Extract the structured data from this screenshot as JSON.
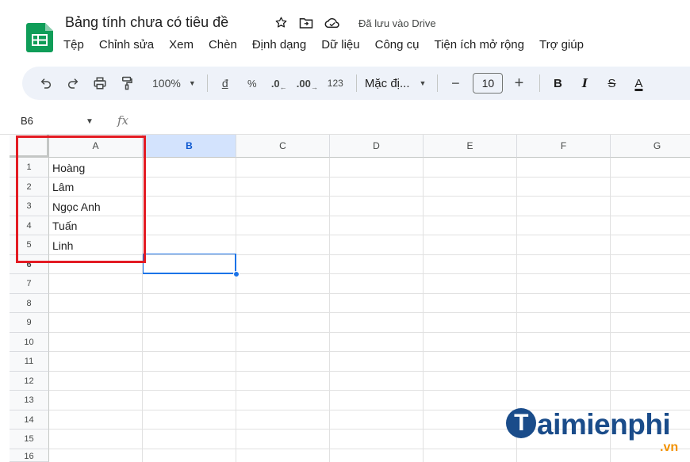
{
  "doc": {
    "title": "Bảng tính chưa có tiêu đề",
    "saved_status": "Đã lưu vào Drive"
  },
  "menu": [
    "Tệp",
    "Chỉnh sửa",
    "Xem",
    "Chèn",
    "Định dạng",
    "Dữ liệu",
    "Công cụ",
    "Tiện ích mở rộng",
    "Trợ giúp"
  ],
  "toolbar": {
    "zoom": "100%",
    "currency": "đ",
    "percent": "%",
    "dec_decrease": ".0",
    "dec_increase": ".00",
    "number_format": "123",
    "font_name": "Mặc đị...",
    "font_size": "10",
    "minus": "−",
    "plus": "+",
    "bold": "B",
    "italic": "I",
    "strike": "S",
    "text_color": "A"
  },
  "name_box": "B6",
  "formula_icon": "fx",
  "columns": [
    "A",
    "B",
    "C",
    "D",
    "E",
    "F",
    "G"
  ],
  "selected_column": "B",
  "rows": [
    "1",
    "2",
    "3",
    "4",
    "5",
    "6",
    "7",
    "8",
    "9",
    "10",
    "11",
    "12",
    "13",
    "14",
    "15",
    "16"
  ],
  "column_a": [
    "Hoàng",
    "Lâm",
    "Ngọc Anh",
    "Tuấn",
    "Linh"
  ],
  "watermark": {
    "brand": "aimienphi",
    "brand_initial": "T",
    "suffix": ".vn"
  },
  "colors": {
    "accent": "#1a73e8",
    "highlight_border": "#e31b23",
    "logo_green": "#0f9d58",
    "watermark_blue": "#1a4c8a",
    "watermark_orange": "#f29100"
  }
}
